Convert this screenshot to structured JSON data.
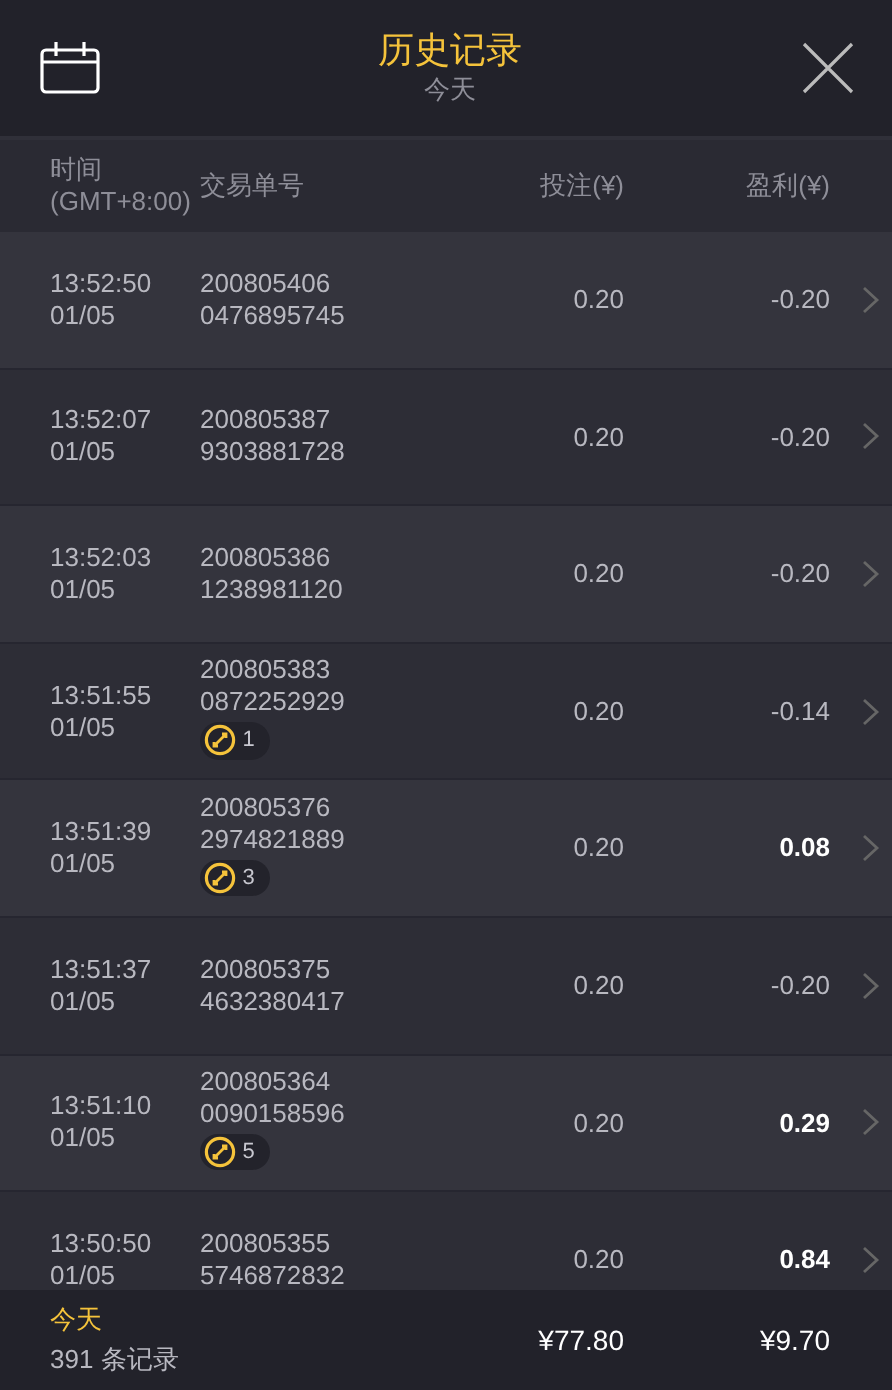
{
  "header": {
    "title": "历史记录",
    "subtitle": "今天"
  },
  "columns": [
    "时间\n(GMT+8:00)",
    "交易单号",
    "投注(¥)",
    "盈利(¥)"
  ],
  "rows": [
    {
      "time": "13:52:50",
      "date": "01/05",
      "order": [
        "200805406",
        "0476895745"
      ],
      "stake": "0.20",
      "profit": "-0.20",
      "gain": false
    },
    {
      "time": "13:52:07",
      "date": "01/05",
      "order": [
        "200805387",
        "9303881728"
      ],
      "stake": "0.20",
      "profit": "-0.20",
      "gain": false
    },
    {
      "time": "13:52:03",
      "date": "01/05",
      "order": [
        "200805386",
        "1238981120"
      ],
      "stake": "0.20",
      "profit": "-0.20",
      "gain": false
    },
    {
      "time": "13:51:55",
      "date": "01/05",
      "order": [
        "200805383",
        "0872252929"
      ],
      "badge": "1",
      "stake": "0.20",
      "profit": "-0.14",
      "gain": false
    },
    {
      "time": "13:51:39",
      "date": "01/05",
      "order": [
        "200805376",
        "2974821889"
      ],
      "badge": "3",
      "stake": "0.20",
      "profit": "0.08",
      "gain": true
    },
    {
      "time": "13:51:37",
      "date": "01/05",
      "order": [
        "200805375",
        "4632380417"
      ],
      "stake": "0.20",
      "profit": "-0.20",
      "gain": false
    },
    {
      "time": "13:51:10",
      "date": "01/05",
      "order": [
        "200805364",
        "0090158596"
      ],
      "badge": "5",
      "stake": "0.20",
      "profit": "0.29",
      "gain": true
    },
    {
      "time": "13:50:50",
      "date": "01/05",
      "order": [
        "200805355",
        "5746872832"
      ],
      "stake": "0.20",
      "profit": "0.84",
      "gain": true
    }
  ],
  "footer": {
    "period": "今天",
    "count": "391 条记录",
    "total_stake": "¥77.80",
    "total_profit": "¥9.70"
  }
}
